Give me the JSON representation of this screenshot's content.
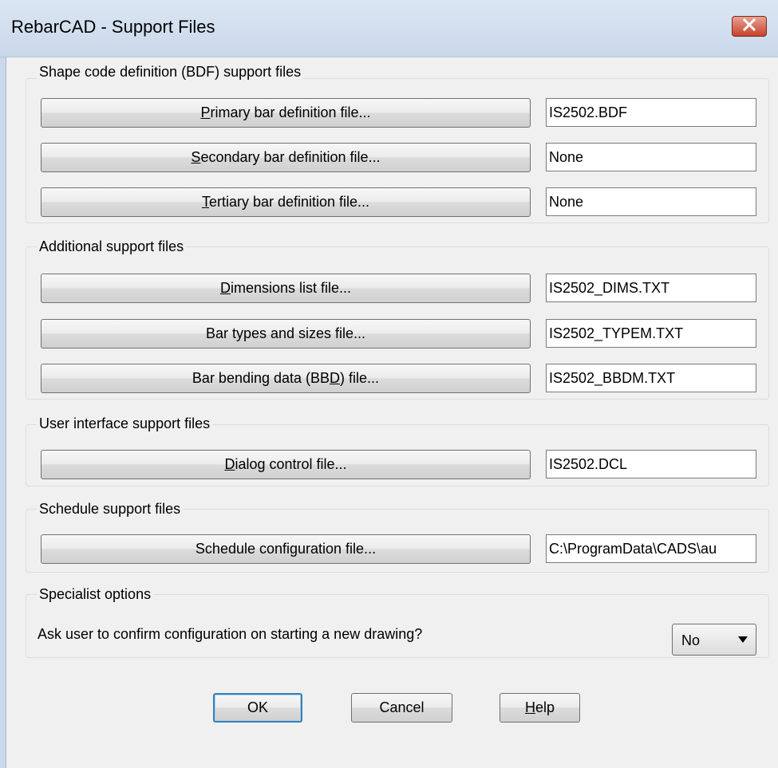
{
  "window": {
    "title": "RebarCAD - Support Files",
    "close_icon": "close-icon"
  },
  "groups": {
    "shape_code": {
      "label": "Shape code definition (BDF) support files",
      "primary": {
        "label_pre": "",
        "accel": "P",
        "label_post": "rimary bar definition file...",
        "value": "IS2502.BDF"
      },
      "secondary": {
        "label_pre": "",
        "accel": "S",
        "label_post": "econdary bar definition file...",
        "value": "None"
      },
      "tertiary": {
        "label_pre": "",
        "accel": "T",
        "label_post": "ertiary bar definition file...",
        "value": "None"
      }
    },
    "additional": {
      "label": "Additional support files",
      "dimensions": {
        "label_pre": "",
        "accel": "D",
        "label_post": "imensions list file...",
        "value": "IS2502_DIMS.TXT"
      },
      "bar_types": {
        "label": "Bar types and sizes file...",
        "value": "IS2502_TYPEM.TXT"
      },
      "bending": {
        "label_pre": "Bar bending data (BB",
        "accel": "D",
        "label_post": ") file...",
        "value": "IS2502_BBDM.TXT"
      }
    },
    "ui": {
      "label": "User interface support files",
      "dialog": {
        "label_pre": "",
        "accel": "D",
        "label_post": "ialog control file...",
        "value": "IS2502.DCL"
      }
    },
    "schedule": {
      "label": "Schedule support files",
      "config": {
        "label": "Schedule configuration file...",
        "value": "C:\\ProgramData\\CADS\\au"
      }
    },
    "specialist": {
      "label": "Specialist options",
      "question": "Ask user to confirm configuration on starting a new drawing?",
      "select_value": "No"
    }
  },
  "buttons": {
    "ok": "OK",
    "cancel": "Cancel",
    "help_accel": "H",
    "help_post": "elp"
  }
}
